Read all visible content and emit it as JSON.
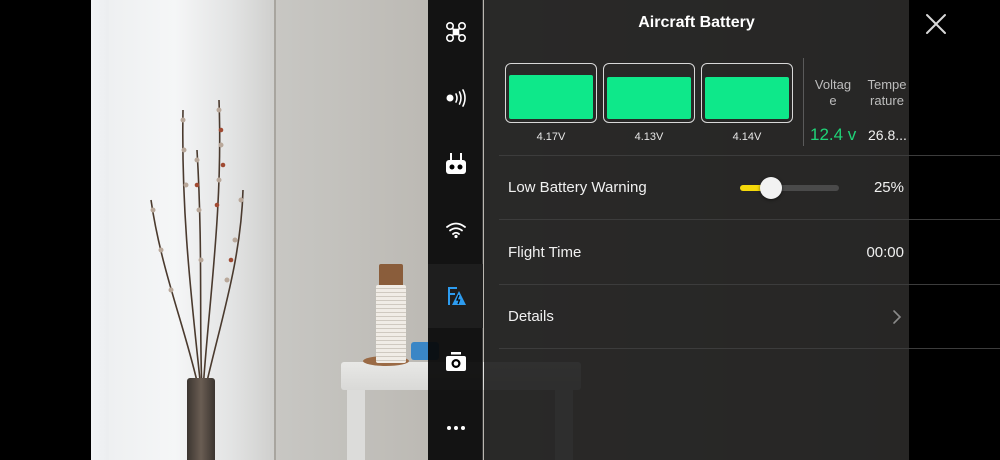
{
  "panel": {
    "title": "Aircraft Battery"
  },
  "sidebar": {
    "items": [
      {
        "icon": "aircraft-icon",
        "active": false
      },
      {
        "icon": "signal-icon",
        "active": false
      },
      {
        "icon": "remote-controller-icon",
        "active": false
      },
      {
        "icon": "wifi-icon",
        "active": false
      },
      {
        "icon": "battery-settings-icon",
        "active": true
      },
      {
        "icon": "camera-icon",
        "active": false
      },
      {
        "icon": "more-icon",
        "active": false
      }
    ]
  },
  "battery": {
    "cells": [
      {
        "voltage": "4.17V",
        "level": 0.82
      },
      {
        "voltage": "4.13V",
        "level": 0.8
      },
      {
        "voltage": "4.14V",
        "level": 0.8
      }
    ],
    "voltage_header": "Voltag e",
    "voltage_value": "12.4 v",
    "temperature_header": "Tempe rature",
    "temperature_value": "26.8..."
  },
  "rows": {
    "low_battery_label": "Low Battery Warning",
    "low_battery_value": "25%",
    "low_battery_level": 0.25,
    "flight_time_label": "Flight Time",
    "flight_time_value": "00:00",
    "details_label": "Details"
  },
  "colors": {
    "cell_fill": "#0ee88a",
    "voltage_accent": "#1fd478",
    "slider_accent": "#f5d90a"
  }
}
